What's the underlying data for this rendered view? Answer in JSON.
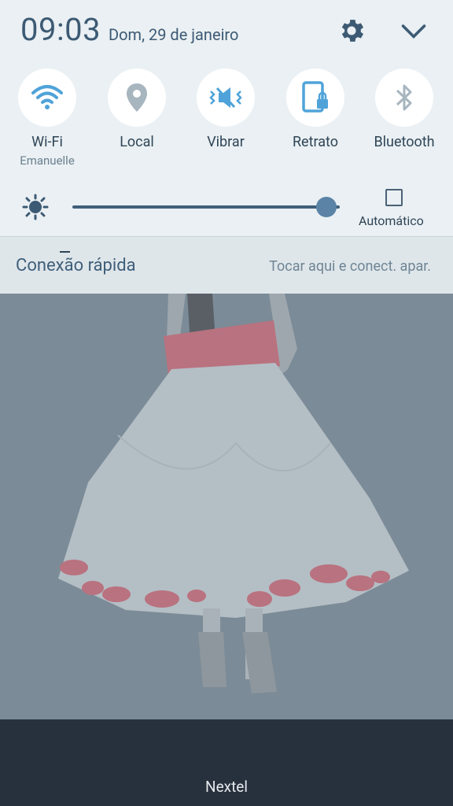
{
  "header": {
    "time": "09:03",
    "date": "Dom, 29 de janeiro",
    "settings_icon": "gear-icon",
    "expand_icon": "chevron-down-icon"
  },
  "quick_settings": [
    {
      "label": "Wi-Fi",
      "sub": "Emanuelle",
      "icon": "wifi-icon",
      "active": true
    },
    {
      "label": "Local",
      "sub": "",
      "icon": "location-icon",
      "active": false
    },
    {
      "label": "Vibrar",
      "sub": "",
      "icon": "vibrate-icon",
      "active": true
    },
    {
      "label": "Retrato",
      "sub": "",
      "icon": "portrait-lock-icon",
      "active": true
    },
    {
      "label": "Bluetooth",
      "sub": "",
      "icon": "bluetooth-icon",
      "active": false
    }
  ],
  "brightness": {
    "level_percent": 95,
    "auto_label": "Automático",
    "auto_checked": false
  },
  "quick_connect": {
    "title": "Conexão rápida",
    "hint": "Tocar aqui e conect. apar."
  },
  "footer": {
    "carrier": "Nextel"
  },
  "colors": {
    "accent": "#3f5f7a",
    "active_icon": "#4fa3d9",
    "inactive_icon": "#a7b5bf",
    "panel_bg": "#eaf0f3",
    "bottom_bar": "#27313d"
  }
}
